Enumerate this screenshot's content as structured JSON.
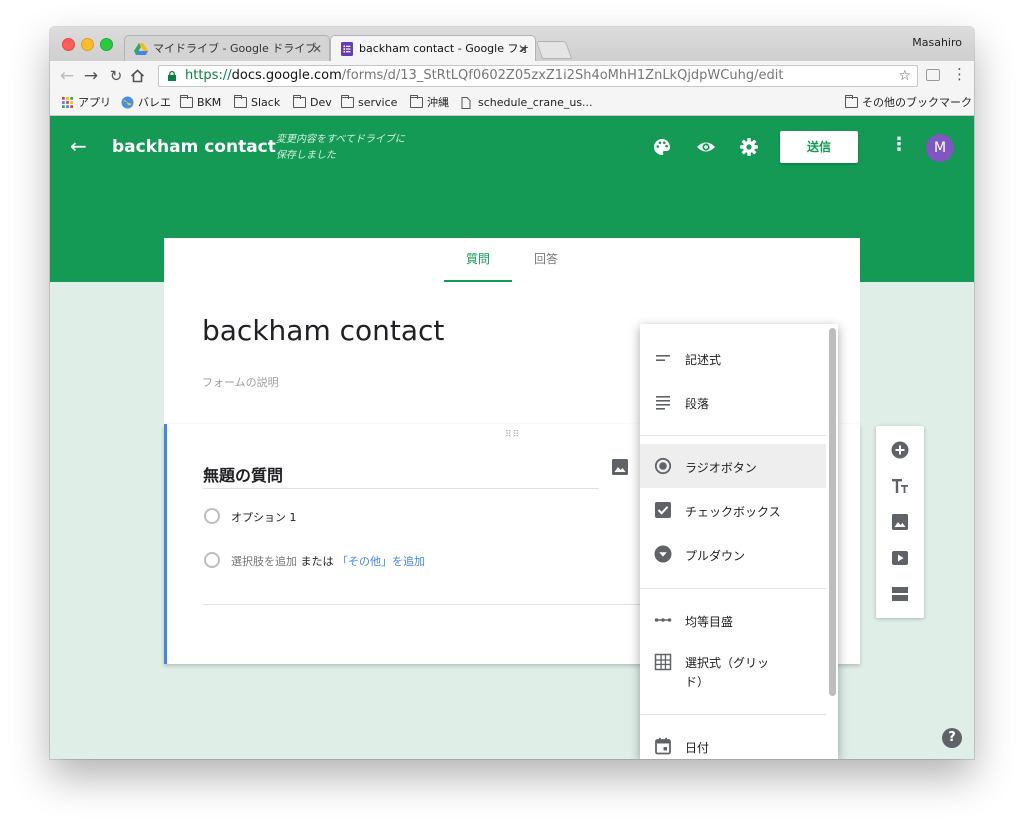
{
  "window": {
    "tabs": [
      {
        "label": "マイドライブ - Google ドライブ",
        "active": false
      },
      {
        "label": "backham contact - Google フォ",
        "active": true
      }
    ],
    "profile_name": "Masahiro"
  },
  "toolbar": {
    "url_scheme": "https://",
    "url_host": "docs.google.com",
    "url_path": "/forms/d/13_StRtLQf0602Z05zxZ1i2Sh4oMhH1ZnLkQjdpWCuhg/edit"
  },
  "bookmarks": [
    {
      "label": "アプリ",
      "icon": "apps-grid-icon"
    },
    {
      "label": "バレエ",
      "icon": "globe-icon"
    },
    {
      "label": "BKM",
      "icon": "folder-icon"
    },
    {
      "label": "Slack",
      "icon": "folder-icon"
    },
    {
      "label": "Dev",
      "icon": "folder-icon"
    },
    {
      "label": "service",
      "icon": "folder-icon"
    },
    {
      "label": "沖縄",
      "icon": "folder-icon"
    },
    {
      "label": "schedule_crane_us...",
      "icon": "page-icon"
    }
  ],
  "other_bookmarks": "その他のブックマーク",
  "header": {
    "form_title": "backham contact",
    "save_status_line1": "変更内容をすべてドライブに",
    "save_status_line2": "保存しました",
    "send_label": "送信",
    "avatar_letter": "M",
    "brand_color": "#149a55"
  },
  "form": {
    "tab_questions": "質問",
    "tab_responses": "回答",
    "title": "backham contact",
    "description_placeholder": "フォームの説明"
  },
  "question": {
    "title": "無題の質問",
    "option1": "オプション 1",
    "add_option": "選択肢を追加",
    "or": "または",
    "add_other": "「その他」を追加"
  },
  "question_types": [
    {
      "label": "記述式",
      "icon": "short-answer-icon"
    },
    {
      "label": "段落",
      "icon": "paragraph-icon"
    },
    {
      "label": "ラジオボタン",
      "icon": "radio-button-icon",
      "selected": true
    },
    {
      "label": "チェックボックス",
      "icon": "checkbox-icon"
    },
    {
      "label": "プルダウン",
      "icon": "dropdown-icon"
    },
    {
      "label": "均等目盛",
      "icon": "linear-scale-icon"
    },
    {
      "label_line1": "選択式（グリッ",
      "label_line2": "ド）",
      "icon": "grid-icon"
    },
    {
      "label": "日付",
      "icon": "date-icon"
    }
  ],
  "help_label": "?"
}
